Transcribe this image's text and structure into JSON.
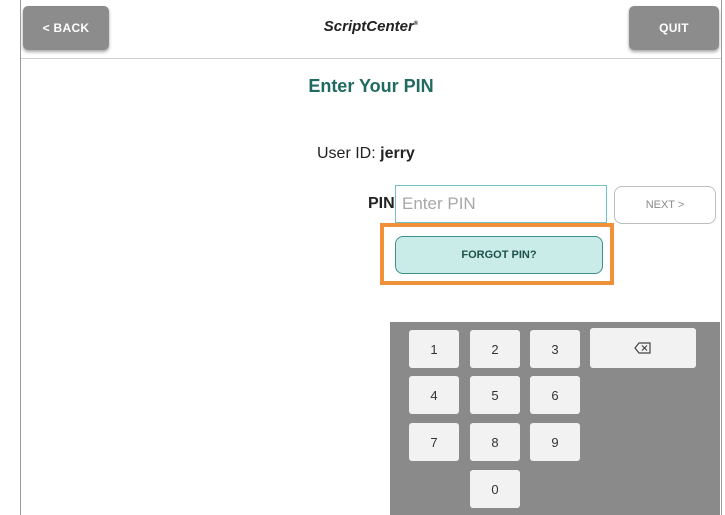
{
  "header": {
    "back_label": "< BACK",
    "title": "ScriptCenter",
    "title_mark": "®",
    "quit_label": "QUIT"
  },
  "page": {
    "title": "Enter Your PIN"
  },
  "user": {
    "label": "User ID:",
    "value": "jerry"
  },
  "pin": {
    "label": "PIN:",
    "placeholder": "Enter PIN",
    "value": ""
  },
  "buttons": {
    "next_label": "NEXT >",
    "forgot_label": "FORGOT PIN?"
  },
  "keypad": {
    "keys": [
      "1",
      "2",
      "3",
      "4",
      "5",
      "6",
      "7",
      "8",
      "9",
      "0"
    ],
    "backspace_icon": "backspace-icon"
  },
  "colors": {
    "title_teal": "#1f6b62",
    "highlight_orange": "#f0913a",
    "forgot_bg": "#c9ece9",
    "header_button_gray": "#8c8c8c",
    "keypad_bg": "#8a8a8a"
  }
}
